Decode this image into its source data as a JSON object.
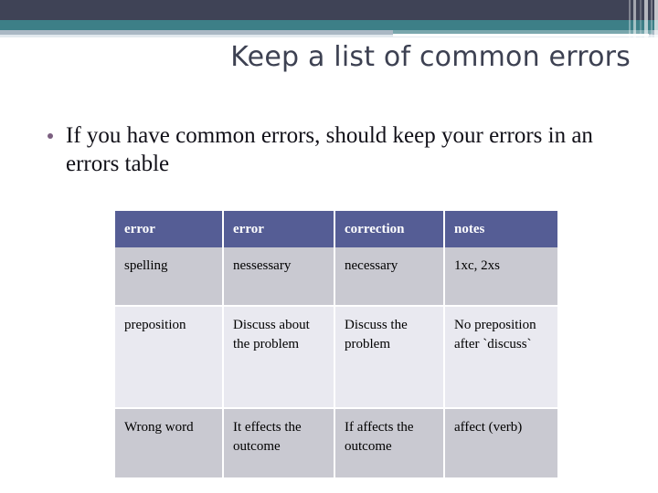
{
  "slide": {
    "title": "Keep a list of common errors",
    "bullets": [
      "If you have common errors, should keep your errors in an errors table"
    ],
    "colors": {
      "band_dark": "#3f4356",
      "band_teal": "#3d7f87",
      "band_pale": "#aab8c4",
      "title_text": "#3d4152",
      "bullet_dot": "#7b5f80",
      "table_header_bg": "#555d95",
      "table_row_odd_bg": "#c9c9d1",
      "table_row_even_bg": "#e9e9f0",
      "body_text": "#111018"
    }
  },
  "table": {
    "headers": [
      "error",
      "error",
      "correction",
      "notes"
    ],
    "rows": [
      {
        "cells": [
          "spelling",
          "nessessary",
          "necessary",
          "1xc, 2xs"
        ]
      },
      {
        "cells": [
          "preposition",
          "Discuss about the problem",
          "Discuss the problem",
          "No preposition after `discuss`"
        ]
      },
      {
        "cells": [
          "Wrong word",
          "It  effects the outcome",
          "If  affects the outcome",
          "affect (verb)"
        ]
      }
    ]
  }
}
